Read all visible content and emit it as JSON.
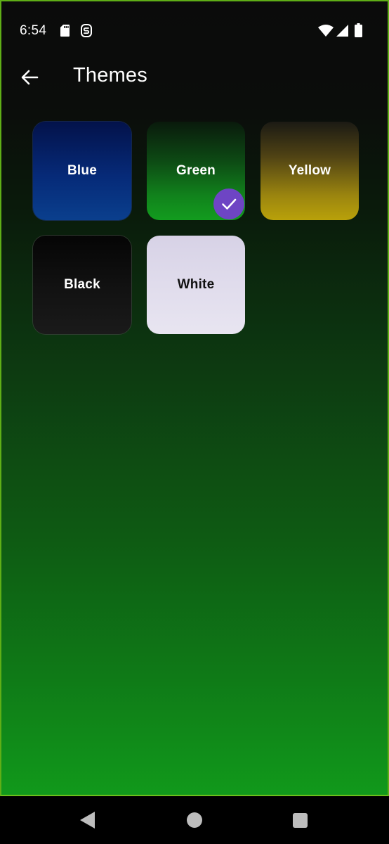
{
  "status_bar": {
    "time": "6:54",
    "icons": [
      "sd-card-icon",
      "s-notification-icon",
      "wifi-icon",
      "cell-signal-icon",
      "battery-icon"
    ]
  },
  "app_bar": {
    "back_icon": "arrow-back-icon",
    "title": "Themes"
  },
  "themes": [
    {
      "id": "blue",
      "label": "Blue",
      "selected": false
    },
    {
      "id": "green",
      "label": "Green",
      "selected": true
    },
    {
      "id": "yellow",
      "label": "Yellow",
      "selected": false
    },
    {
      "id": "black",
      "label": "Black",
      "selected": false
    },
    {
      "id": "white",
      "label": "White",
      "selected": false
    }
  ],
  "selected_badge_icon": "check-icon",
  "nav_bar": {
    "icons": [
      "nav-back-icon",
      "nav-home-icon",
      "nav-recents-icon"
    ]
  },
  "colors": {
    "frame_border": "#5fae17",
    "selected_badge": "#6e45c4",
    "background_top": "#0b0b0b",
    "background_bottom": "#11991b"
  }
}
